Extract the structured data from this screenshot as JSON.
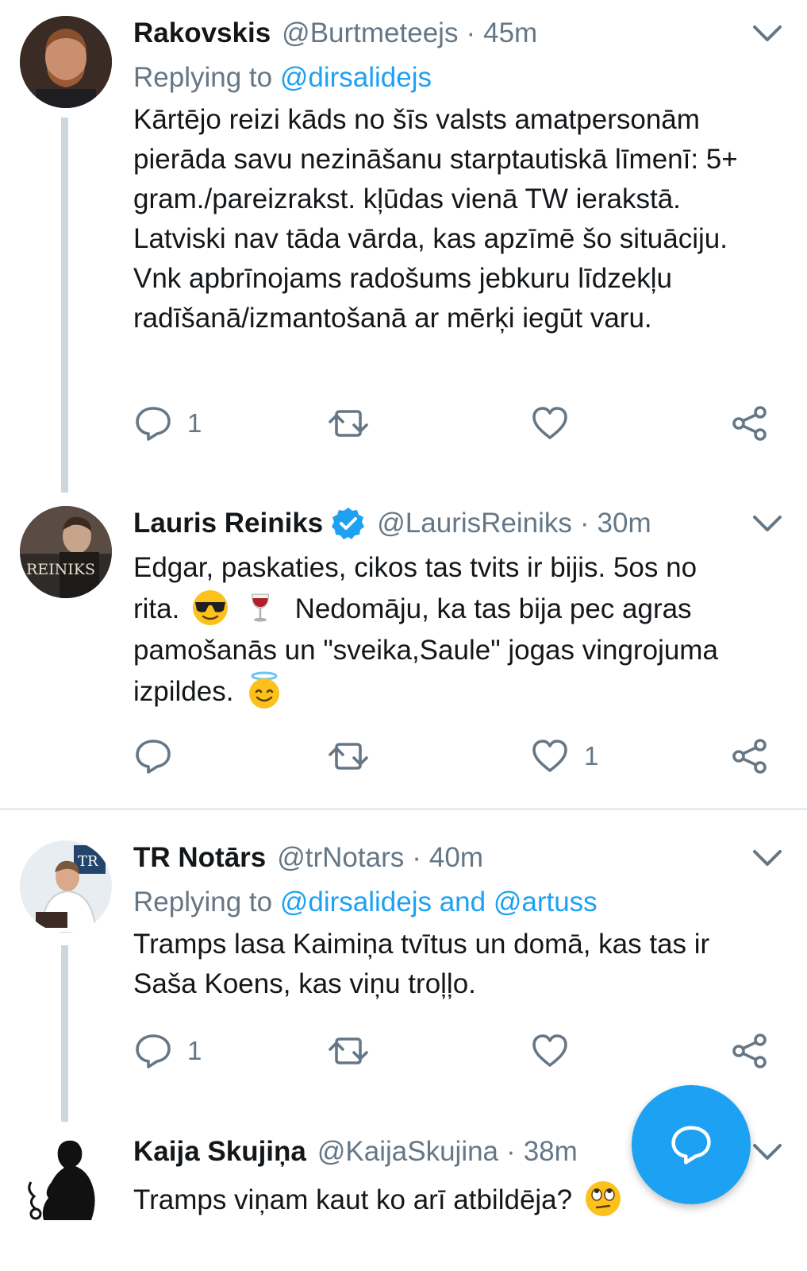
{
  "colors": {
    "accent": "#1da1f2",
    "muted": "#657786",
    "text": "#14171a",
    "divider": "#e6ecf0"
  },
  "tweets": [
    {
      "name": "Rakovskis",
      "handle": "@Burtmeteejs",
      "time": "45m",
      "reply_prefix": "Replying to",
      "reply_mentions": "@dirsalidejs",
      "text": "Kārtējo reizi kāds no šīs valsts amatpersonām pierāda savu nezināšanu starptautiskā līmenī: 5+ gram./pareizrakst. kļūdas vienā TW ierakstā. Latviski nav tāda vārda, kas apzīmē šo situāciju. Vnk apbrīnojams radošums jebkuru līdzekļu radīšanā/izmantošanā ar mērķi iegūt varu.",
      "reply_count": "1",
      "retweet_count": "",
      "like_count": ""
    },
    {
      "name": "Lauris Reiniks",
      "handle": "@LaurisReiniks",
      "time": "30m",
      "text_1": "Edgar, paskaties, cikos tas tvits ir bijis. 5os no",
      "text_2": "rita.",
      "text_3": "Nedomāju, ka tas bija pec agras",
      "text_4": "pamošanās un \"sveika,Saule\" jogas vingrojuma",
      "text_5": "izpildes.",
      "avatar_text": "REINIKS",
      "reply_count": "",
      "retweet_count": "",
      "like_count": "1"
    },
    {
      "name": "TR Notārs",
      "handle": "@trNotars",
      "time": "40m",
      "reply_prefix": "Replying to",
      "reply_mentions": "@dirsalidejs and @artuss",
      "text": "Tramps lasa Kaimiņa tvītus un domā, kas tas ir Saša Koens, kas viņu troļļo.",
      "avatar_text": "TR",
      "reply_count": "1",
      "retweet_count": "",
      "like_count": ""
    },
    {
      "name": "Kaija Skujiņa",
      "handle": "@KaijaSkujina",
      "time": "38m",
      "text": "Tramps viņam kaut ko arī atbildēja?"
    }
  ],
  "icons": {
    "reply": "reply-icon",
    "retweet": "retweet-icon",
    "like": "heart-icon",
    "share": "share-icon",
    "compose": "compose-reply-icon"
  }
}
